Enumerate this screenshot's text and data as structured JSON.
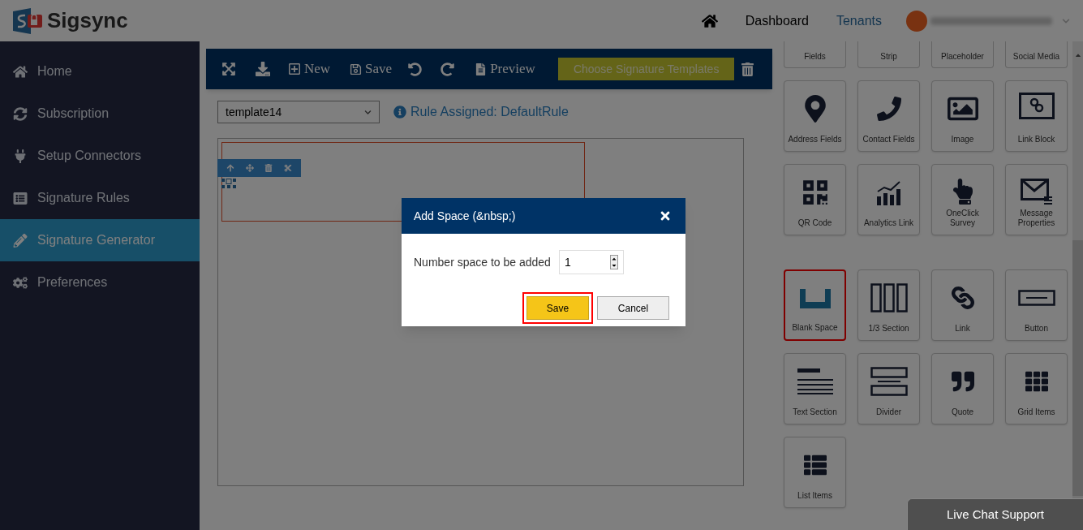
{
  "header": {
    "logo_text": "Sigsync",
    "nav": [
      {
        "label": "Dashboard",
        "selected": false
      },
      {
        "label": "Tenants",
        "selected": true
      }
    ]
  },
  "sidebar": {
    "items": [
      {
        "label": "Home",
        "selected": false
      },
      {
        "label": "Subscription",
        "selected": false
      },
      {
        "label": "Setup Connectors",
        "selected": false
      },
      {
        "label": "Signature Rules",
        "selected": false
      },
      {
        "label": "Signature Generator",
        "selected": true
      },
      {
        "label": "Preferences",
        "selected": false
      }
    ]
  },
  "toolbar": {
    "new_label": "New",
    "save_label": "Save",
    "preview_label": "Preview",
    "templates_button": "Choose Signature Templates"
  },
  "editor": {
    "template_select": "template14",
    "rule_text": "Rule Assigned: DefaultRule"
  },
  "palette": {
    "partial_tiles": [
      {
        "label": "Fields"
      },
      {
        "label": "Strip"
      },
      {
        "label": "Placeholder"
      },
      {
        "label": "Social Media"
      }
    ],
    "tiles": [
      {
        "label": "Address Fields",
        "selected": false
      },
      {
        "label": "Contact Fields",
        "selected": false
      },
      {
        "label": "Image",
        "selected": false
      },
      {
        "label": "Link Block",
        "selected": false
      },
      {
        "label": "QR Code",
        "selected": false
      },
      {
        "label": "Analytics Link",
        "selected": false
      },
      {
        "label": "OneClick Survey",
        "selected": false
      },
      {
        "label": "Message Properties",
        "selected": false
      },
      {
        "label": "Blank Space",
        "selected": true
      },
      {
        "label": "1/3 Section",
        "selected": false
      },
      {
        "label": "Link",
        "selected": false
      },
      {
        "label": "Button",
        "selected": false
      },
      {
        "label": "Text Section",
        "selected": false
      },
      {
        "label": "Divider",
        "selected": false
      },
      {
        "label": "Quote",
        "selected": false
      },
      {
        "label": "Grid Items",
        "selected": false
      },
      {
        "label": "List Items",
        "selected": false
      }
    ]
  },
  "dialog": {
    "title": "Add Space (&nbsp;)",
    "field_label": "Number space to be added",
    "value": "1",
    "buttons": [
      {
        "label": "Save",
        "kind": "primary",
        "highlighted": true
      },
      {
        "label": "Cancel",
        "kind": "secondary",
        "highlighted": false
      }
    ]
  },
  "live_chat": "Live Chat Support"
}
